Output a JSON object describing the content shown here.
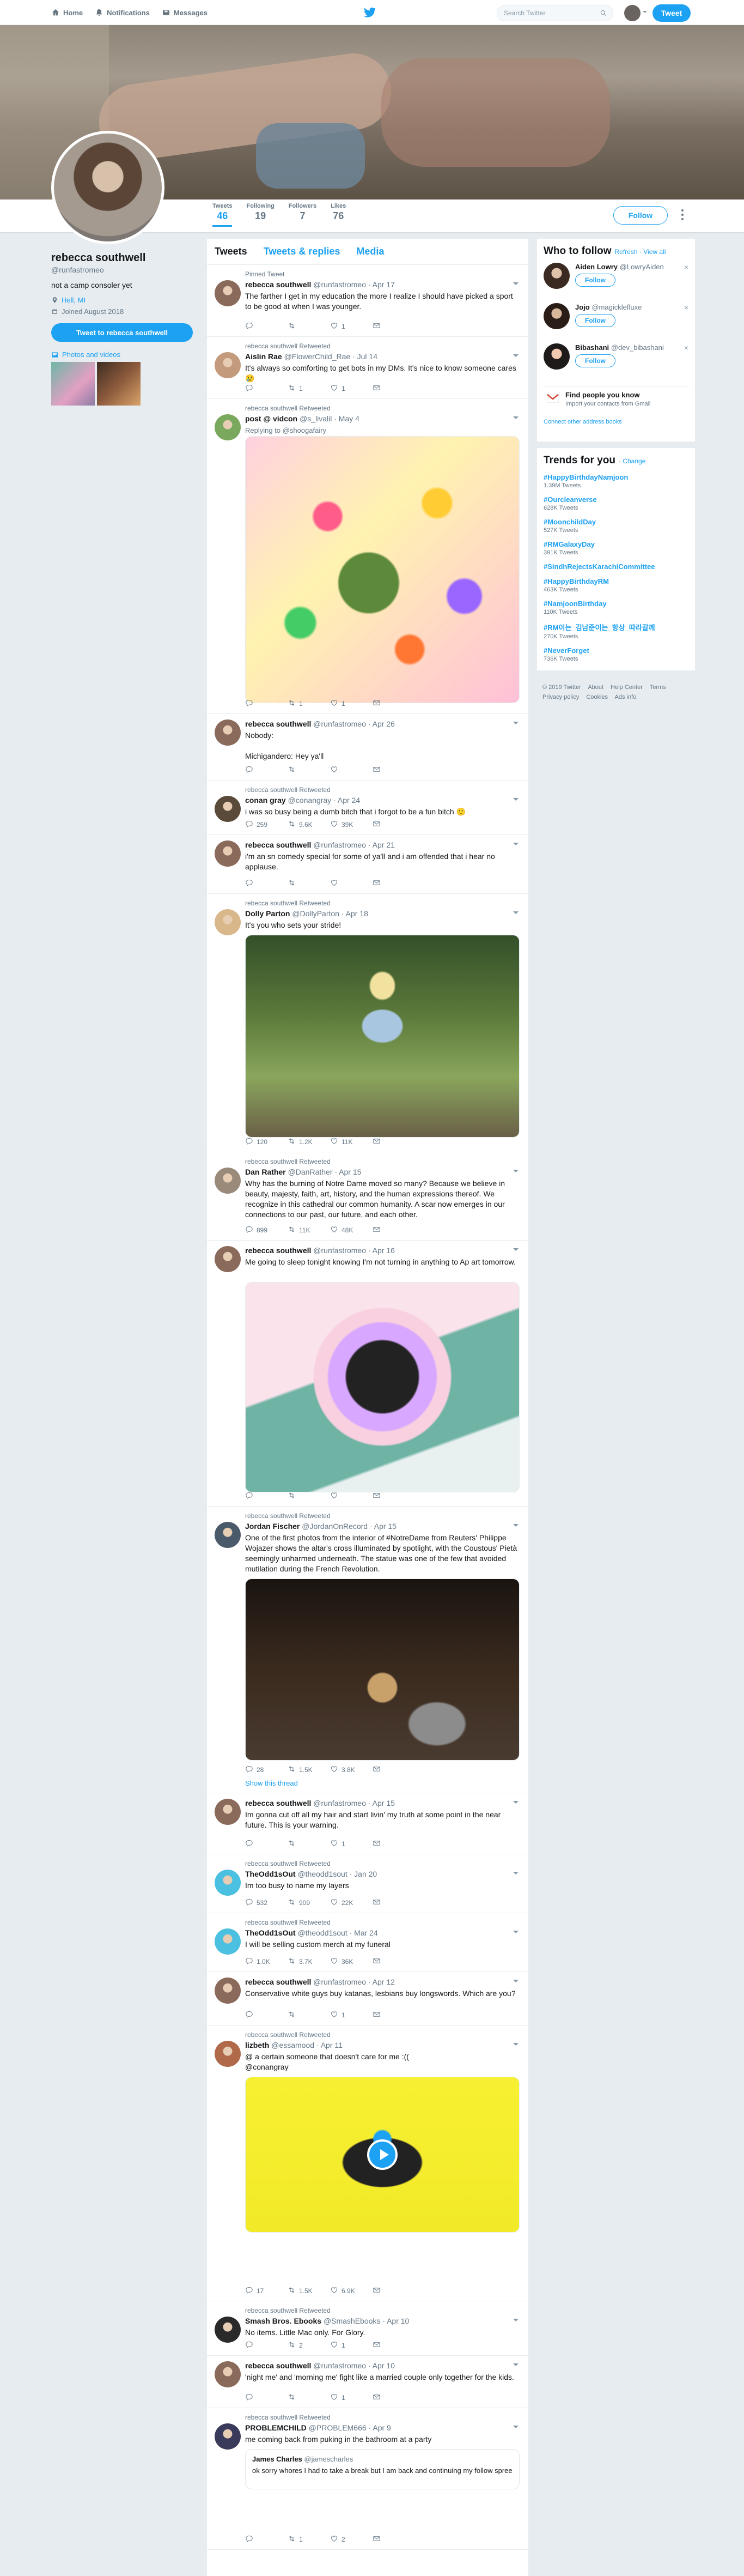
{
  "topbar": {
    "nav": [
      {
        "label": "Home",
        "icon": "home-icon"
      },
      {
        "label": "Notifications",
        "icon": "bell-icon"
      },
      {
        "label": "Messages",
        "icon": "envelope-icon"
      }
    ],
    "search_placeholder": "Search Twitter",
    "tweet_button": "Tweet"
  },
  "profile": {
    "name": "rebecca southwell",
    "handle": "@runfastromeo",
    "bio": "not a camp consoler yet",
    "location": "Hell, MI",
    "joined": "Joined August 2018",
    "tweet_to": "Tweet to rebecca southwell",
    "photos_label": "Photos and videos",
    "follow_label": "Follow"
  },
  "stats": [
    {
      "label": "Tweets",
      "value": "46"
    },
    {
      "label": "Following",
      "value": "19"
    },
    {
      "label": "Followers",
      "value": "7"
    },
    {
      "label": "Likes",
      "value": "76"
    }
  ],
  "timeline_tabs": [
    "Tweets",
    "Tweets & replies",
    "Media"
  ],
  "tweets": [
    {
      "context": "Pinned Tweet",
      "name": "rebecca southwell",
      "handle": "@runfastromeo · Apr 17",
      "text": "The farther I get in my education the more I realize I should have picked a sport to be good at when I was younger.",
      "reply": "",
      "retweet": "",
      "like": "1"
    },
    {
      "context": "rebecca southwell Retweeted",
      "name": "Aislin Rae",
      "handle": "@FlowerChild_Rae · Jul 14",
      "text": "It's always so comforting to get bots in my DMs. It's nice to know someone cares 😢",
      "reply": "",
      "retweet": "1",
      "like": "1"
    },
    {
      "context": "rebecca southwell Retweeted",
      "name": "post @ vidcon",
      "handle": "@s_livalil · May 4",
      "replying": "Replying to @shoogafairy",
      "text": "",
      "reply": "",
      "retweet": "1",
      "like": "1"
    },
    {
      "context": "",
      "name": "rebecca southwell",
      "handle": "@runfastromeo · Apr 26",
      "text": "Nobody:\n\nMichigandero: Hey ya'll",
      "reply": "",
      "retweet": "",
      "like": ""
    },
    {
      "context": "rebecca southwell Retweeted",
      "name": "conan gray",
      "handle": "@conangray · Apr 24",
      "text": "i was so busy being a dumb bitch that i forgot to be a fun bitch 🙂",
      "reply": "259",
      "retweet": "9.6K",
      "like": "39K"
    },
    {
      "context": "",
      "name": "rebecca southwell",
      "handle": "@runfastromeo · Apr 21",
      "text": "i'm an sn comedy special for some of ya'll and i am offended that i hear no applause.",
      "reply": "",
      "retweet": "",
      "like": ""
    },
    {
      "context": "rebecca southwell Retweeted",
      "name": "Dolly Parton",
      "handle": "@DollyParton · Apr 18",
      "text": "It's you who sets your stride!",
      "reply": "120",
      "retweet": "1.2K",
      "like": "11K"
    },
    {
      "context": "rebecca southwell Retweeted",
      "name": "Dan Rather",
      "handle": "@DanRather · Apr 15",
      "text": "Why has the burning of Notre Dame moved so many? Because we believe in beauty, majesty, faith, art, history, and the human expressions thereof. We recognize in this cathedral our common humanity. A scar now emerges in our connections to our past, our future, and each other.",
      "reply": "899",
      "retweet": "11K",
      "like": "48K"
    },
    {
      "context": "",
      "name": "rebecca southwell",
      "handle": "@runfastromeo · Apr 16",
      "text": "Me going to sleep tonight knowing I'm not turning in anything to Ap art tomorrow.",
      "reply": "",
      "retweet": "",
      "like": ""
    },
    {
      "context": "rebecca southwell Retweeted",
      "name": "Jordan Fischer",
      "handle": "@JordanOnRecord · Apr 15",
      "text": "One of the first photos from the interior of #NotreDame from Reuters' Philippe Wojazer shows the altar's cross illuminated by spotlight, with the Coustous' Pietà seemingly unharmed underneath. The statue was one of the few that avoided mutilation during the French Revolution.",
      "reply": "28",
      "retweet": "1.5K",
      "like": "3.8K",
      "show_thread": "Show this thread"
    },
    {
      "context": "",
      "name": "rebecca southwell",
      "handle": "@runfastromeo · Apr 15",
      "text": "Im gonna cut off all my hair and start livin' my truth at some point in the near future. This is your warning.",
      "reply": "",
      "retweet": "",
      "like": "1"
    },
    {
      "context": "rebecca southwell Retweeted",
      "name": "TheOdd1sOut",
      "handle": "@theodd1sout · Jan 20",
      "text": "Im too busy to name my layers",
      "reply": "532",
      "retweet": "909",
      "like": "22K"
    },
    {
      "context": "rebecca southwell Retweeted",
      "name": "TheOdd1sOut",
      "handle": "@theodd1sout · Mar 24",
      "text": "I will be selling custom merch at my funeral",
      "reply": "1.0K",
      "retweet": "3.7K",
      "like": "36K"
    },
    {
      "context": "",
      "name": "rebecca southwell",
      "handle": "@runfastromeo · Apr 12",
      "text": "Conservative white guys buy katanas, lesbians buy longswords. Which are you?",
      "reply": "",
      "retweet": "",
      "like": "1"
    },
    {
      "context": "rebecca southwell Retweeted",
      "name": "lizbeth",
      "handle": "@essamood · Apr 11",
      "text": "@ a certain someone that doesn't care for me :((\n@conangray",
      "reply": "17",
      "retweet": "1.5K",
      "like": "6.9K"
    },
    {
      "context": "rebecca southwell Retweeted",
      "name": "Smash Bros. Ebooks",
      "handle": "@SmashEbooks · Apr 10",
      "text": "No items. Little Mac only. For Glory.",
      "reply": "",
      "retweet": "2",
      "like": "1"
    },
    {
      "context": "",
      "name": "rebecca southwell",
      "handle": "@runfastromeo · Apr 10",
      "text": "'night me' and 'morning me' fight like a married couple only together for the kids.",
      "reply": "",
      "retweet": "",
      "like": "1"
    },
    {
      "context": "rebecca southwell Retweeted",
      "name": "PROBLEMCHILD",
      "handle": "@PROBLEM666 · Apr 9",
      "text": "me coming back from puking in the bathroom at a party",
      "reply": "",
      "retweet": "1",
      "like": "2",
      "quote_name": "James Charles",
      "quote_handle": "@jamescharles",
      "quote_text": "ok sorry whores I had to take a break but I am back and continuing my follow spree"
    }
  ],
  "who_to_follow": {
    "title": "Who to follow",
    "refresh": "Refresh",
    "view_all": "View all",
    "users": [
      {
        "name": "Aiden Lowry",
        "handle": "@LowryAiden"
      },
      {
        "name": "Jojo",
        "handle": "@magicklefluxe"
      },
      {
        "name": "Bibashani",
        "handle": "@dev_bibashani"
      }
    ],
    "follow": "Follow",
    "find_title": "Find people you know",
    "find_sub": "Import your contacts from Gmail",
    "connect": "Connect other address books"
  },
  "trends": {
    "title": "Trends for you",
    "change": "Change",
    "items": [
      {
        "tag": "#HappyBirthdayNamjoon",
        "count": "1.39M Tweets"
      },
      {
        "tag": "#Ourcleanverse",
        "count": "628K Tweets"
      },
      {
        "tag": "#MoonchildDay",
        "count": "527K Tweets"
      },
      {
        "tag": "#RMGalaxyDay",
        "count": "391K Tweets"
      },
      {
        "tag": "#SindhRejectsKarachiCommittee",
        "count": ""
      },
      {
        "tag": "#HappyBirthdayRM",
        "count": "463K Tweets"
      },
      {
        "tag": "#NamjoonBirthday",
        "count": "110K Tweets"
      },
      {
        "tag": "#RM이는_김남준이는_항상_따라갈께",
        "count": "270K Tweets"
      },
      {
        "tag": "#NeverForget",
        "count": "736K Tweets"
      }
    ]
  },
  "footer": [
    "© 2019 Twitter",
    "About",
    "Help Center",
    "Terms",
    "Privacy policy",
    "Cookies",
    "Ads info"
  ]
}
